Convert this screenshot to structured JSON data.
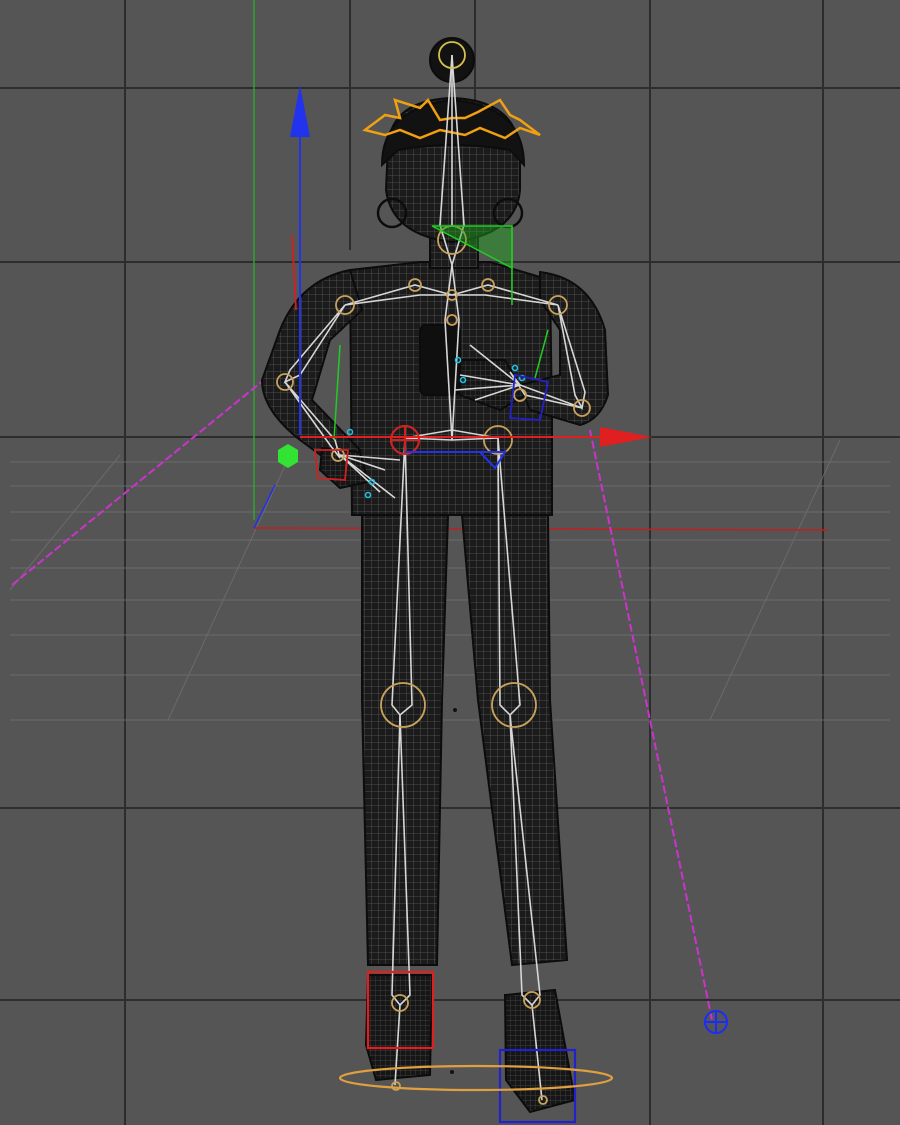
{
  "viewport": {
    "view": "front",
    "background_color": "#555555",
    "grid_color": "#2b2b2b",
    "floor_grid_color": "#6a6a6a"
  },
  "scene": {
    "character": {
      "type": "rigged-character",
      "display": "wireframe-with-joints",
      "mesh_color": "#1a1a1a"
    },
    "joint_color": "#c8a25a",
    "bone_color": "#d6d6d6",
    "hair_control_color": "#f0a010"
  },
  "gizmo": {
    "x_axis_color": "#e02020",
    "y_axis_color": "#22cc22",
    "z_axis_color": "#2233ee",
    "pivot_color": "#33e333"
  },
  "ik_guides": {
    "pole_line_color": "#cc33cc",
    "pole_target_color": "#1a2bff"
  },
  "foot_controls": {
    "left_color": "#e02020",
    "right_color": "#2222cc",
    "ground_ring_color": "#e0a040"
  }
}
